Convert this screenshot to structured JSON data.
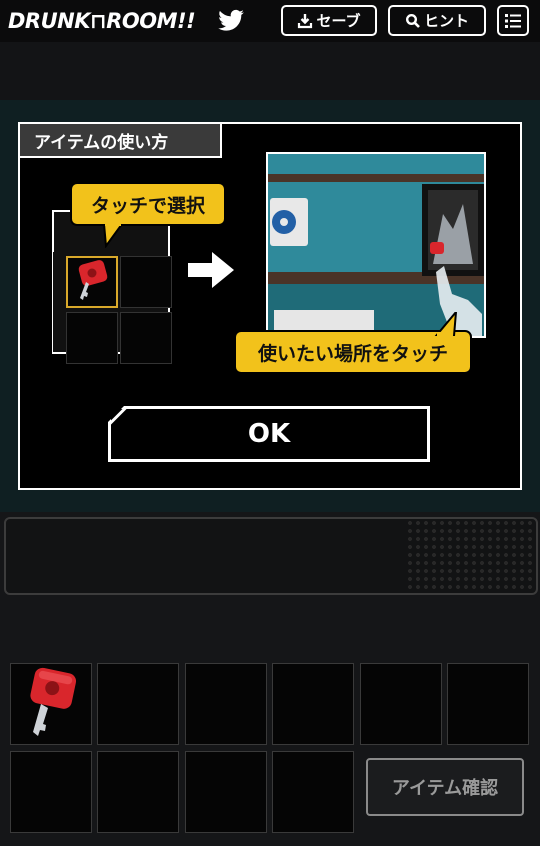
{
  "header": {
    "logo": "DRUNK⊓ROOM!!",
    "save_label": "セーブ",
    "hint_label": "ヒント"
  },
  "modal": {
    "title": "アイテムの使い方",
    "callout_select": "タッチで選択",
    "callout_use": "使いたい場所をタッチ",
    "ok_label": "OK"
  },
  "inventory": {
    "confirm_label": "アイテム確認"
  },
  "icons": {
    "twitter": "twitter-icon",
    "download": "download-icon",
    "search": "search-icon",
    "menu": "menu-icon",
    "key": "key-icon"
  },
  "colors": {
    "callout": "#f2c21b",
    "selected_border": "#d9a92b",
    "key_red": "#d9262c",
    "scene_wall": "#2f8a9b"
  }
}
